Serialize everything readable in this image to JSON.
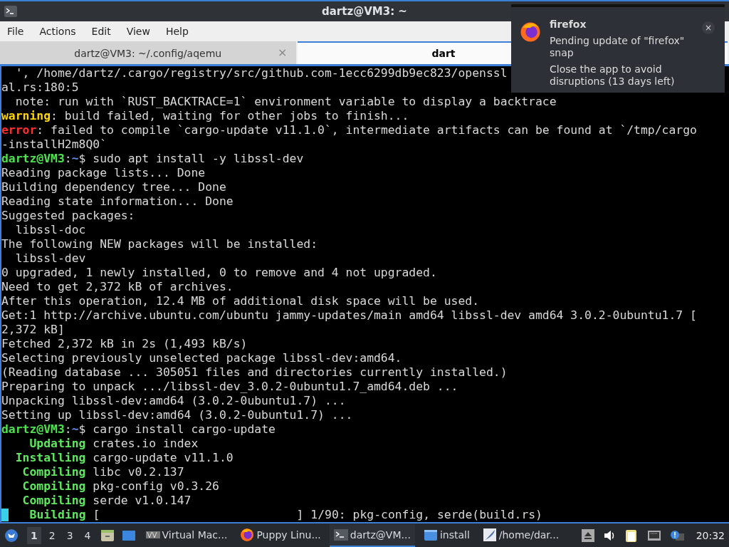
{
  "window": {
    "title": "dartz@VM3: ~"
  },
  "menu": [
    "File",
    "Actions",
    "Edit",
    "View",
    "Help"
  ],
  "tabs": [
    {
      "label": "dartz@VM3: ~/.config/aqemu",
      "selected": false,
      "close": "×"
    },
    {
      "label": "dart",
      "selected": true
    }
  ],
  "terminal": {
    "lines": [
      [
        {
          "kind": "plain",
          "text": "  ', /home/dartz/.cargo/registry/src/github.com-1ecc6299db9ec823/openssl"
        }
      ],
      [
        {
          "kind": "plain",
          "text": "al.rs:180:5"
        }
      ],
      [
        {
          "kind": "plain",
          "text": "  note: run with `RUST_BACKTRACE=1` environment variable to display a backtrace"
        }
      ],
      [
        {
          "kind": "warning",
          "text": "warning"
        },
        {
          "kind": "plain",
          "text": ": build failed, waiting for other jobs to finish..."
        }
      ],
      [
        {
          "kind": "error",
          "text": "error"
        },
        {
          "kind": "plain",
          "text": ": failed to compile `cargo-update v11.1.0`, intermediate artifacts can be found at `/tmp/cargo"
        }
      ],
      [
        {
          "kind": "plain",
          "text": "-installH2m8Q0`"
        }
      ],
      [
        {
          "kind": "user",
          "text": "dartz@VM3"
        },
        {
          "kind": "plain",
          "text": ":"
        },
        {
          "kind": "path",
          "text": "~"
        },
        {
          "kind": "plain",
          "text": "$ sudo apt install -y libssl-dev"
        }
      ],
      [
        {
          "kind": "plain",
          "text": "Reading package lists... Done"
        }
      ],
      [
        {
          "kind": "plain",
          "text": "Building dependency tree... Done"
        }
      ],
      [
        {
          "kind": "plain",
          "text": "Reading state information... Done"
        }
      ],
      [
        {
          "kind": "plain",
          "text": "Suggested packages:"
        }
      ],
      [
        {
          "kind": "plain",
          "text": "  libssl-doc"
        }
      ],
      [
        {
          "kind": "plain",
          "text": "The following NEW packages will be installed:"
        }
      ],
      [
        {
          "kind": "plain",
          "text": "  libssl-dev"
        }
      ],
      [
        {
          "kind": "plain",
          "text": "0 upgraded, 1 newly installed, 0 to remove and 4 not upgraded."
        }
      ],
      [
        {
          "kind": "plain",
          "text": "Need to get 2,372 kB of archives."
        }
      ],
      [
        {
          "kind": "plain",
          "text": "After this operation, 12.4 MB of additional disk space will be used."
        }
      ],
      [
        {
          "kind": "plain",
          "text": "Get:1 http://archive.ubuntu.com/ubuntu jammy-updates/main amd64 libssl-dev amd64 3.0.2-0ubuntu1.7 ["
        }
      ],
      [
        {
          "kind": "plain",
          "text": "2,372 kB]"
        }
      ],
      [
        {
          "kind": "plain",
          "text": "Fetched 2,372 kB in 2s (1,493 kB/s)"
        }
      ],
      [
        {
          "kind": "plain",
          "text": "Selecting previously unselected package libssl-dev:amd64."
        }
      ],
      [
        {
          "kind": "plain",
          "text": "(Reading database ... 305051 files and directories currently installed.)"
        }
      ],
      [
        {
          "kind": "plain",
          "text": "Preparing to unpack .../libssl-dev_3.0.2-0ubuntu1.7_amd64.deb ..."
        }
      ],
      [
        {
          "kind": "plain",
          "text": "Unpacking libssl-dev:amd64 (3.0.2-0ubuntu1.7) ..."
        }
      ],
      [
        {
          "kind": "plain",
          "text": "Setting up libssl-dev:amd64 (3.0.2-0ubuntu1.7) ..."
        }
      ],
      [
        {
          "kind": "user",
          "text": "dartz@VM3"
        },
        {
          "kind": "plain",
          "text": ":"
        },
        {
          "kind": "path",
          "text": "~"
        },
        {
          "kind": "plain",
          "text": "$ cargo install cargo-update"
        }
      ],
      [
        {
          "kind": "status",
          "text": "    Updating"
        },
        {
          "kind": "plain",
          "text": " crates.io index"
        }
      ],
      [
        {
          "kind": "status",
          "text": "  Installing"
        },
        {
          "kind": "plain",
          "text": " cargo-update v11.1.0"
        }
      ],
      [
        {
          "kind": "status",
          "text": "   Compiling"
        },
        {
          "kind": "plain",
          "text": " libc v0.2.137"
        }
      ],
      [
        {
          "kind": "status",
          "text": "   Compiling"
        },
        {
          "kind": "plain",
          "text": " pkg-config v0.3.26"
        }
      ],
      [
        {
          "kind": "status",
          "text": "   Compiling"
        },
        {
          "kind": "plain",
          "text": " serde v1.0.147"
        }
      ],
      [
        {
          "kind": "cursor"
        },
        {
          "kind": "status",
          "text": "   Building"
        },
        {
          "kind": "plain",
          "text": " [                            ] 1/90: pkg-config, serde(build.rs)"
        }
      ]
    ]
  },
  "notification": {
    "app": "firefox",
    "body": "Pending update of \"firefox\" snap",
    "detail": "Close the app to avoid disruptions (13 days left)",
    "close": "×"
  },
  "taskbar": {
    "workspaces": [
      {
        "label": "1",
        "selected": true
      },
      {
        "label": "2",
        "selected": false
      },
      {
        "label": "3",
        "selected": false
      },
      {
        "label": "4",
        "selected": false
      }
    ],
    "tasks": [
      {
        "kind": "vm",
        "label": "Virtual Mac...",
        "selected": false
      },
      {
        "kind": "firefox",
        "label": "Puppy Linu...",
        "selected": false
      },
      {
        "kind": "terminal",
        "label": "dartz@VM...",
        "selected": true
      },
      {
        "kind": "folder",
        "label": "install",
        "selected": false
      },
      {
        "kind": "editor",
        "label": "/home/dar...",
        "selected": false
      }
    ],
    "clock": "20:32"
  }
}
